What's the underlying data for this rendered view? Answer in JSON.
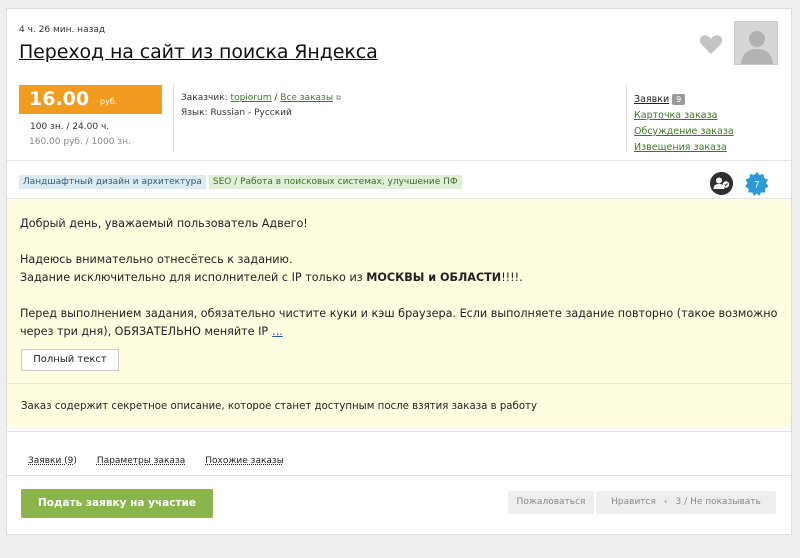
{
  "order": {
    "time_ago": "4 ч. 26 мин. назад",
    "title": "Переход на сайт из поиска Яндекса"
  },
  "price": {
    "value": "16.00",
    "currency": "руб.",
    "line1": "100 зн. / 24.00 ч.",
    "line2": "160.00 руб. / 1000 зн."
  },
  "meta": {
    "customer_label": "Заказчик:",
    "customer_name": "topiorum",
    "all_orders": "Все заказы",
    "language": "Язык: Russian - Русский"
  },
  "side_links": {
    "applications": "Заявки",
    "applications_count": "9",
    "order_card": "Карточка заказа",
    "discussion": "Обсуждение заказа",
    "notifications": "Извещения заказа"
  },
  "tags": [
    "Ландшафтный дизайн и архитектура",
    "SEO / Работа в поисковых системах, улучшение ПФ"
  ],
  "level_badge": "7",
  "description": {
    "greeting": "Добрый день, уважаемый пользователь Адвего!",
    "line2": "Надеюсь внимательно отнесётесь к заданию.",
    "line3_prefix": "Задание исключительно для исполнителей с IP только из ",
    "line3_bold": "МОСКВЫ и ОБЛАСТИ",
    "line3_suffix": "!!!!.",
    "line4": "Перед выполнением задания, обязательно чистите куки и кэш браузера. Если выполняете задание повторно (такое возможно через три дня), ОБЯЗАТЕЛЬНО меняйте IP",
    "more": "..."
  },
  "full_text_button": "Полный текст",
  "secret_notice": "Заказ содержит секретное описание, которое станет доступным после взятия заказа в работу",
  "tabs": [
    "Заявки (9)",
    "Параметры заказа",
    "Похожие заказы"
  ],
  "actions": {
    "apply": "Подать заявку на участие",
    "complain": "Пожаловаться",
    "like": "Нравится",
    "like_count": "3",
    "hide": "Не показывать",
    "separator": "‹",
    "divider": "/"
  },
  "colors": {
    "price_bg": "#f29c1f",
    "apply_bg": "#8ab54a",
    "description_bg": "#fffde0",
    "link": "#3a7a25",
    "level_badge": "#2b9ad6"
  },
  "icons": [
    "heart-icon",
    "avatar-placeholder",
    "user-group-icon",
    "level-badge-icon",
    "external-link-icon"
  ]
}
